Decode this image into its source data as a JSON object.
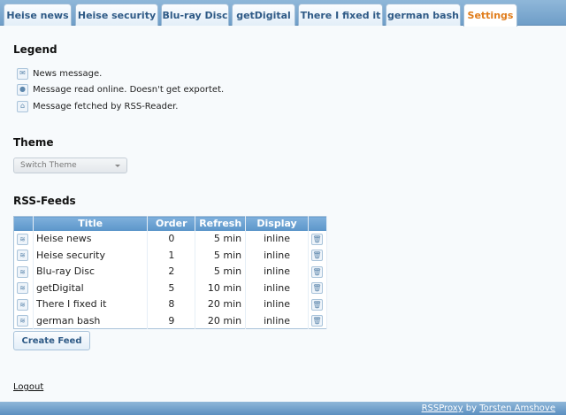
{
  "tabs": [
    {
      "label": "Heise news",
      "active": false
    },
    {
      "label": "Heise security",
      "active": false
    },
    {
      "label": "Blu-ray Disc",
      "active": false
    },
    {
      "label": "getDigital",
      "active": false
    },
    {
      "label": "There I fixed it",
      "active": false
    },
    {
      "label": "german bash",
      "active": false
    },
    {
      "label": "Settings",
      "active": true
    }
  ],
  "legend": {
    "heading": "Legend",
    "items": [
      {
        "icon": "envelope-icon",
        "text": "News message."
      },
      {
        "icon": "read-online-icon",
        "text": "Message read online. Doesn't get exportet."
      },
      {
        "icon": "rss-reader-icon",
        "text": "Message fetched by RSS-Reader."
      }
    ]
  },
  "theme": {
    "heading": "Theme",
    "select_value": "Switch Theme"
  },
  "feeds": {
    "heading": "RSS-Feeds",
    "columns": [
      "",
      "Title",
      "Order",
      "Refresh",
      "Display",
      ""
    ],
    "rows": [
      {
        "title": "Heise news",
        "order": "0",
        "refresh": "5 min",
        "display": "inline"
      },
      {
        "title": "Heise security",
        "order": "1",
        "refresh": "5 min",
        "display": "inline"
      },
      {
        "title": "Blu-ray Disc",
        "order": "2",
        "refresh": "5 min",
        "display": "inline"
      },
      {
        "title": "getDigital",
        "order": "5",
        "refresh": "10 min",
        "display": "inline"
      },
      {
        "title": "There I fixed it",
        "order": "8",
        "refresh": "20 min",
        "display": "inline"
      },
      {
        "title": "german bash",
        "order": "9",
        "refresh": "20 min",
        "display": "inline"
      }
    ],
    "create_label": "Create Feed"
  },
  "logout_label": "Logout",
  "footer": {
    "app_name": "RSSProxy",
    "by": " by ",
    "author": "Torsten Amshove"
  },
  "colors": {
    "accent": "#e07c1a",
    "header_blue": "#6f9ec8"
  }
}
